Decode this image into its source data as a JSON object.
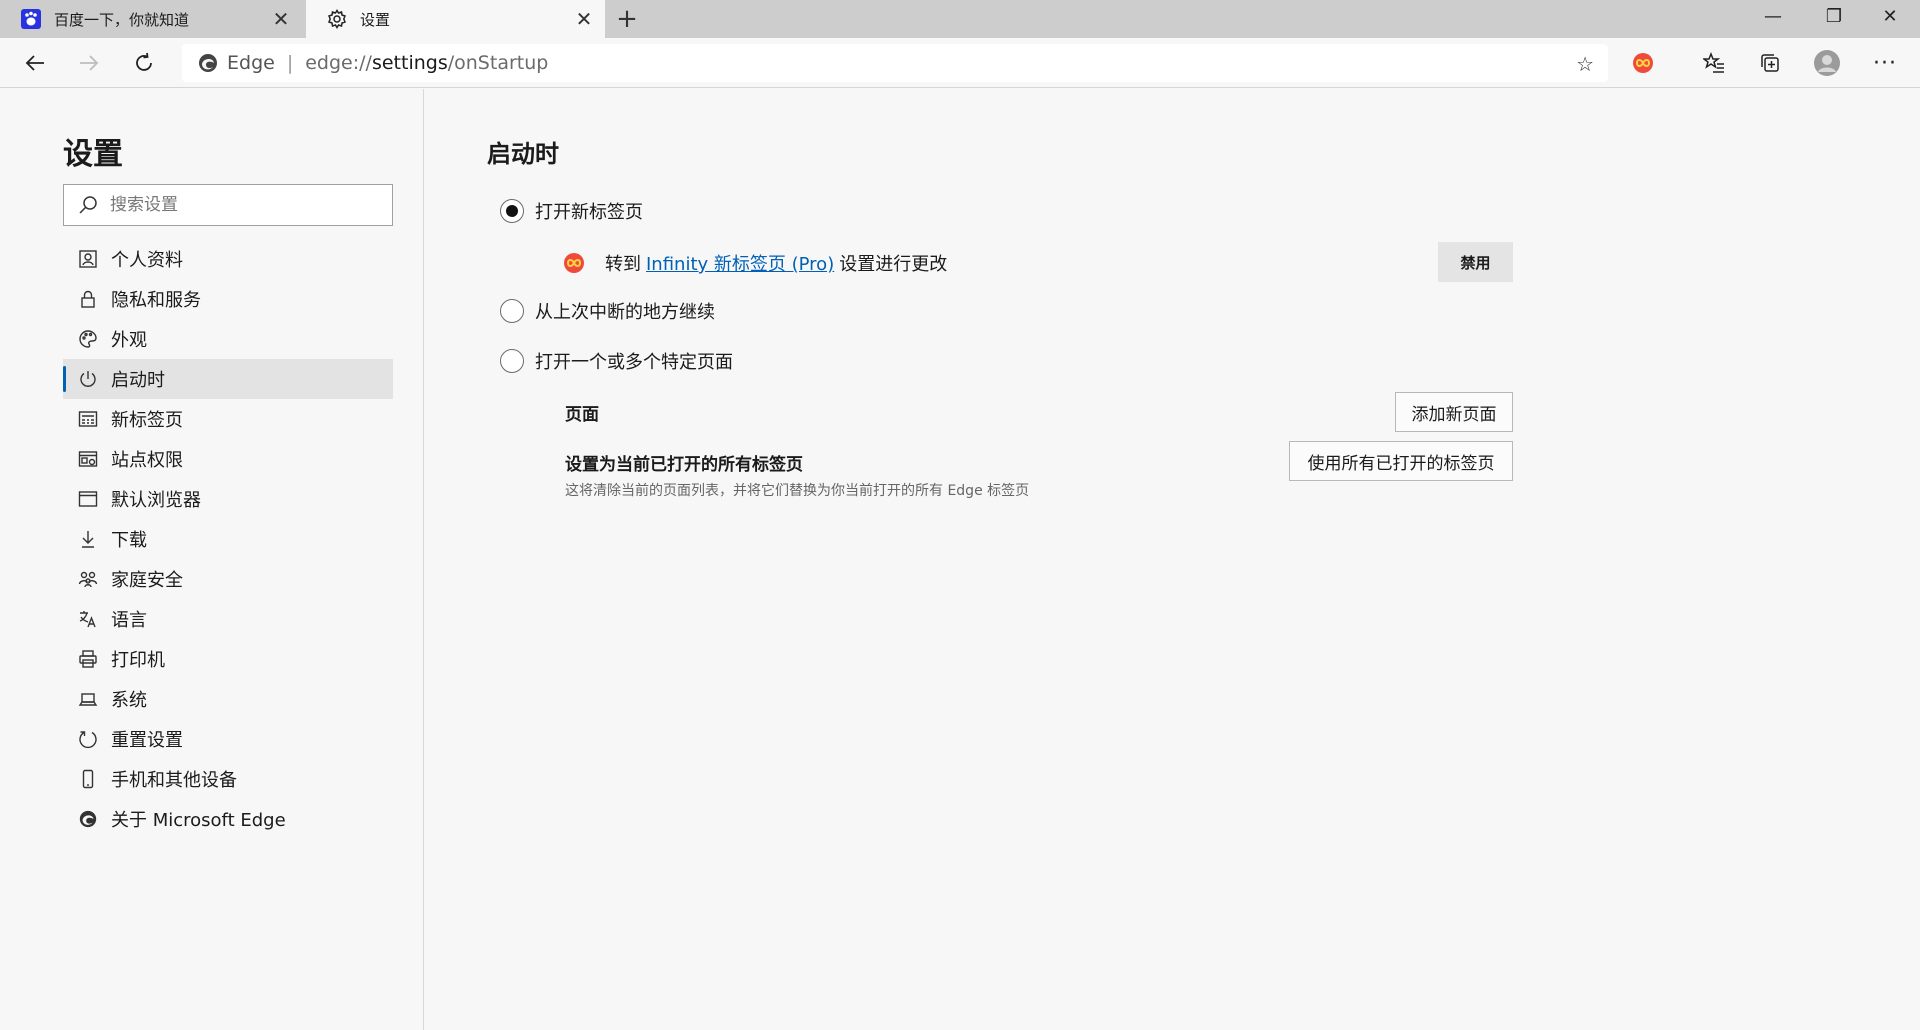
{
  "tabs": [
    {
      "title": "百度一下，你就知道",
      "icon": "baidu-paw-icon",
      "active": false
    },
    {
      "title": "设置",
      "icon": "gear-icon",
      "active": true
    }
  ],
  "toolbar": {
    "brand": "Edge",
    "separator": "|",
    "url_prefix": "edge://",
    "url_main": "settings",
    "url_suffix": "/onStartup"
  },
  "sidebar": {
    "title": "设置",
    "search_placeholder": "搜索设置",
    "items": [
      {
        "label": "个人资料",
        "icon": "profile-icon"
      },
      {
        "label": "隐私和服务",
        "icon": "lock-icon"
      },
      {
        "label": "外观",
        "icon": "palette-icon"
      },
      {
        "label": "启动时",
        "icon": "power-icon",
        "active": true
      },
      {
        "label": "新标签页",
        "icon": "newtab-icon"
      },
      {
        "label": "站点权限",
        "icon": "site-permissions-icon"
      },
      {
        "label": "默认浏览器",
        "icon": "browser-icon"
      },
      {
        "label": "下载",
        "icon": "download-icon"
      },
      {
        "label": "家庭安全",
        "icon": "family-icon"
      },
      {
        "label": "语言",
        "icon": "language-icon"
      },
      {
        "label": "打印机",
        "icon": "printer-icon"
      },
      {
        "label": "系统",
        "icon": "system-icon"
      },
      {
        "label": "重置设置",
        "icon": "reset-icon"
      },
      {
        "label": "手机和其他设备",
        "icon": "phone-icon"
      },
      {
        "label": "关于 Microsoft Edge",
        "icon": "edge-logo-icon"
      }
    ]
  },
  "content": {
    "title": "启动时",
    "options": [
      {
        "label": "打开新标签页",
        "selected": true
      },
      {
        "label": "从上次中断的地方继续",
        "selected": false
      },
      {
        "label": "打开一个或多个特定页面",
        "selected": false
      }
    ],
    "extension_notice": {
      "prefix": "转到",
      "link": "Infinity 新标签页 (Pro)",
      "suffix": "设置进行更改",
      "disable_button": "禁用"
    },
    "pages_label": "页面",
    "add_page_button": "添加新页面",
    "set_current_label": "设置为当前已打开的所有标签页",
    "set_current_desc": "这将清除当前的页面列表，并将它们替换为你当前打开的所有 Edge 标签页",
    "use_all_button": "使用所有已打开的标签页"
  }
}
